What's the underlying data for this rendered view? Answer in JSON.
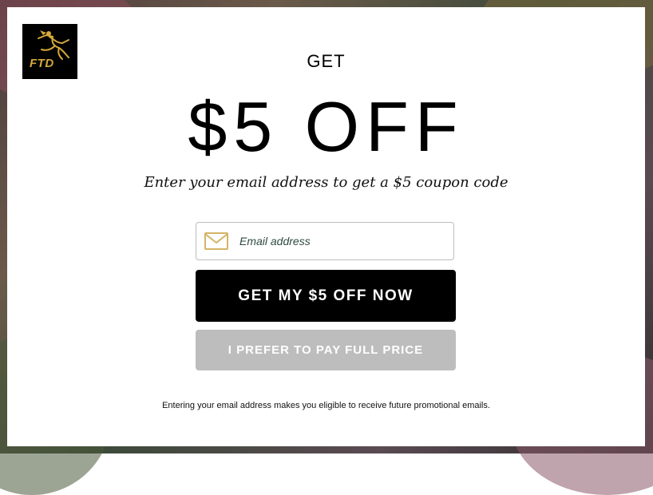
{
  "modal": {
    "logo_text": "FTD",
    "headline_small": "GET",
    "headline_big": "$5 OFF",
    "subhead": "Enter your email address to get a $5 coupon code",
    "email": {
      "placeholder": "Email address",
      "value": "",
      "icon": "mail-icon"
    },
    "primary_button": "GET MY $5 OFF NOW",
    "secondary_button": "I PREFER TO PAY FULL PRICE",
    "disclaimer": "Entering your email address makes you eligible to receive future promotional emails."
  },
  "colors": {
    "primary_button_bg": "#000000",
    "secondary_button_bg": "#bdbdbd",
    "logo_gold": "#d4a93a",
    "mail_icon": "#d4b466"
  }
}
